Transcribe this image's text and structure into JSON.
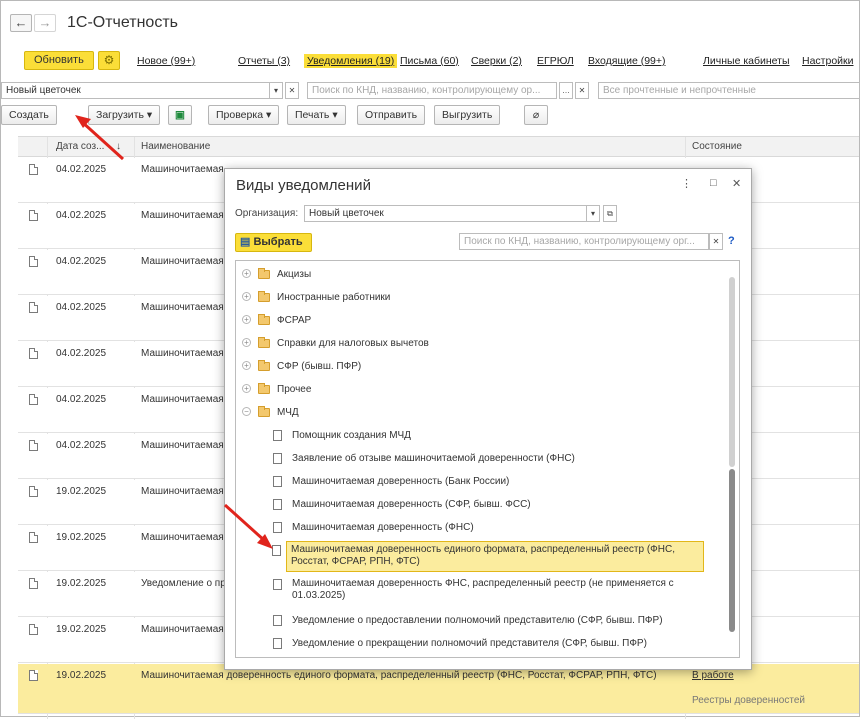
{
  "app": {
    "title": "1С-Отчетность"
  },
  "nav": {
    "refresh": "Обновить",
    "links": [
      {
        "label": "Новое (99+)",
        "active": false
      },
      {
        "label": "Отчеты (3)",
        "active": false
      },
      {
        "label": "Уведомления (19)",
        "active": true
      },
      {
        "label": "Письма (60)",
        "active": false
      },
      {
        "label": "Сверки (2)",
        "active": false
      },
      {
        "label": "ЕГРЮЛ",
        "active": false
      },
      {
        "label": "Входящие (99+)",
        "active": false
      },
      {
        "label": "Личные кабинеты",
        "active": false
      },
      {
        "label": "Настройки",
        "active": false
      }
    ]
  },
  "filters": {
    "organization": "Новый цветочек",
    "search_placeholder": "Поиск по КНД, названию, контролирующему ор...",
    "status_placeholder": "Все прочтенные и непрочтенные"
  },
  "toolbar": {
    "create": "Создать",
    "upload": "Загрузить",
    "check": "Проверка",
    "print": "Печать",
    "send": "Отправить",
    "export": "Выгрузить"
  },
  "table": {
    "columns": {
      "date": "Дата соз...",
      "name": "Наименование",
      "state": "Состояние"
    },
    "rows": [
      {
        "date": "04.02.2025",
        "name": "Машиночитаемая",
        "state": "",
        "state2": "веренностей"
      },
      {
        "date": "04.02.2025",
        "name": "Машиночитаемая",
        "state": "",
        "state2": "веренностей"
      },
      {
        "date": "04.02.2025",
        "name": "Машиночитаемая",
        "state": "",
        "state2": "веренностей"
      },
      {
        "date": "04.02.2025",
        "name": "Машиночитаемая",
        "state": "",
        "state2": "веренностей"
      },
      {
        "date": "04.02.2025",
        "name": "Машиночитаемая",
        "state": "",
        "state2": "веренностей"
      },
      {
        "date": "04.02.2025",
        "name": "Машиночитаемая",
        "state": "",
        "state2": "веренностей"
      },
      {
        "date": "04.02.2025",
        "name": "Машиночитаемая",
        "state": "",
        "state2": "веренностей"
      },
      {
        "date": "19.02.2025",
        "name": "Машиночитаемая",
        "state": "",
        "state2": ""
      },
      {
        "date": "19.02.2025",
        "name": "Машиночитаемая",
        "state": "",
        "state2": ""
      },
      {
        "date": "19.02.2025",
        "name": "Уведомление о пр",
        "state": "",
        "state2": ""
      },
      {
        "date": "19.02.2025",
        "name": "Машиночитаемая",
        "state": "",
        "state2": ""
      }
    ],
    "selected_row": {
      "date": "19.02.2025",
      "name": "Машиночитаемая доверенность единого формата, распределенный реестр (ФНС, Росстат, ФСРАР, РПН, ФТС)",
      "state": "В работе",
      "state2": "Реестры доверенностей"
    }
  },
  "dialog": {
    "title": "Виды уведомлений",
    "org_label": "Организация:",
    "org_value": "Новый цветочек",
    "choose": "Выбрать",
    "search_placeholder": "Поиск по КНД, названию, контролирующему орг...",
    "help": "?",
    "folders": [
      {
        "label": "Акцизы",
        "expanded": false
      },
      {
        "label": "Иностранные работники",
        "expanded": false
      },
      {
        "label": "ФСРАР",
        "expanded": false
      },
      {
        "label": "Справки для налоговых вычетов",
        "expanded": false
      },
      {
        "label": "СФР (бывш. ПФР)",
        "expanded": false
      },
      {
        "label": "Прочее",
        "expanded": false
      },
      {
        "label": "МЧД",
        "expanded": true
      }
    ],
    "items": [
      "Помощник создания МЧД",
      "Заявление об отзыве машиночитаемой доверенности (ФНС)",
      "Машиночитаемая доверенность (Банк России)",
      "Машиночитаемая доверенность (СФР, бывш. ФСС)",
      "Машиночитаемая доверенность (ФНС)"
    ],
    "selected_item": "Машиночитаемая доверенность единого формата, распределенный реестр (ФНС, Росстат, ФСРАР, РПН, ФТС)",
    "items_after": [
      "Машиночитаемая доверенность ФНС, распределенный реестр (не применяется с 01.03.2025)",
      "Уведомление о предоставлении полномочий представителю (СФР, бывш. ПФР)",
      "Уведомление о прекращении полномочий представителя (СФР, бывш. ПФР)"
    ]
  },
  "colors": {
    "accent": "#fbde38",
    "selection": "#fbec9e",
    "arrow": "#e0241c"
  }
}
